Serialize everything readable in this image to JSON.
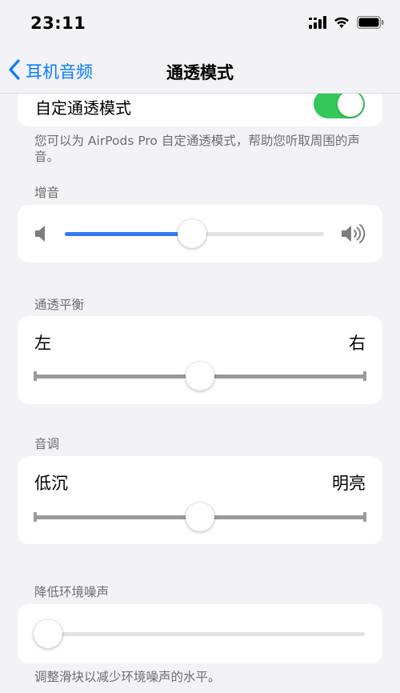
{
  "status_bar": {
    "time": "23:11",
    "icons": [
      "signal-icon",
      "wifi-icon",
      "battery-icon"
    ]
  },
  "nav": {
    "back_label": "耳机音频",
    "title": "通透模式"
  },
  "custom_transparency": {
    "label": "自定通透模式",
    "enabled": true,
    "footnote": "您可以为 AirPods Pro 自定通透模式，帮助您听取周围的声音。"
  },
  "amplification": {
    "section_label": "增音",
    "value_fraction": 0.49,
    "icons": [
      "volume-low-icon",
      "volume-high-icon"
    ]
  },
  "balance": {
    "section_label": "通透平衡",
    "left_label": "左",
    "right_label": "右",
    "value_fraction": 0.5
  },
  "tone": {
    "section_label": "音调",
    "low_label": "低沉",
    "high_label": "明亮",
    "value_fraction": 0.5
  },
  "ambient_noise_reduction": {
    "section_label": "降低环境噪声",
    "value_fraction": 0.0,
    "footnote": "调整滑块以减少环境噪声的水平。"
  },
  "colors": {
    "accent": "#0a7cff",
    "toggle_on": "#34c759",
    "slider_fill": "#3478f6"
  }
}
